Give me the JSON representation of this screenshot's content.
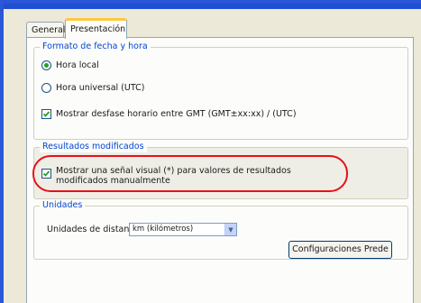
{
  "tabs": [
    {
      "label": "General",
      "active": false
    },
    {
      "label": "Presentación",
      "active": true
    }
  ],
  "date_group": {
    "legend": "Formato de fecha y hora",
    "radio_local": "Hora local",
    "radio_utc": "Hora universal (UTC)",
    "radio_selected": "Hora local",
    "gmt_checkbox": "Mostrar desfase horario entre GMT (GMT±xx:xx) / (UTC)",
    "gmt_checked": true
  },
  "results_group": {
    "legend": "Resultados modificados",
    "visual_checkbox": "Mostrar una señal visual (*) para valores de resultados modificados manualmente",
    "visual_checked": true
  },
  "units_group": {
    "legend": "Unidades",
    "distance_label": "Unidades de distancia:",
    "distance_value": "km (kilómetros)",
    "config_button": "Configuraciones Prede"
  },
  "colors": {
    "highlight": "#e8101a",
    "legend_text": "#0046d5",
    "active_tab_accent": "#ffc83c"
  }
}
